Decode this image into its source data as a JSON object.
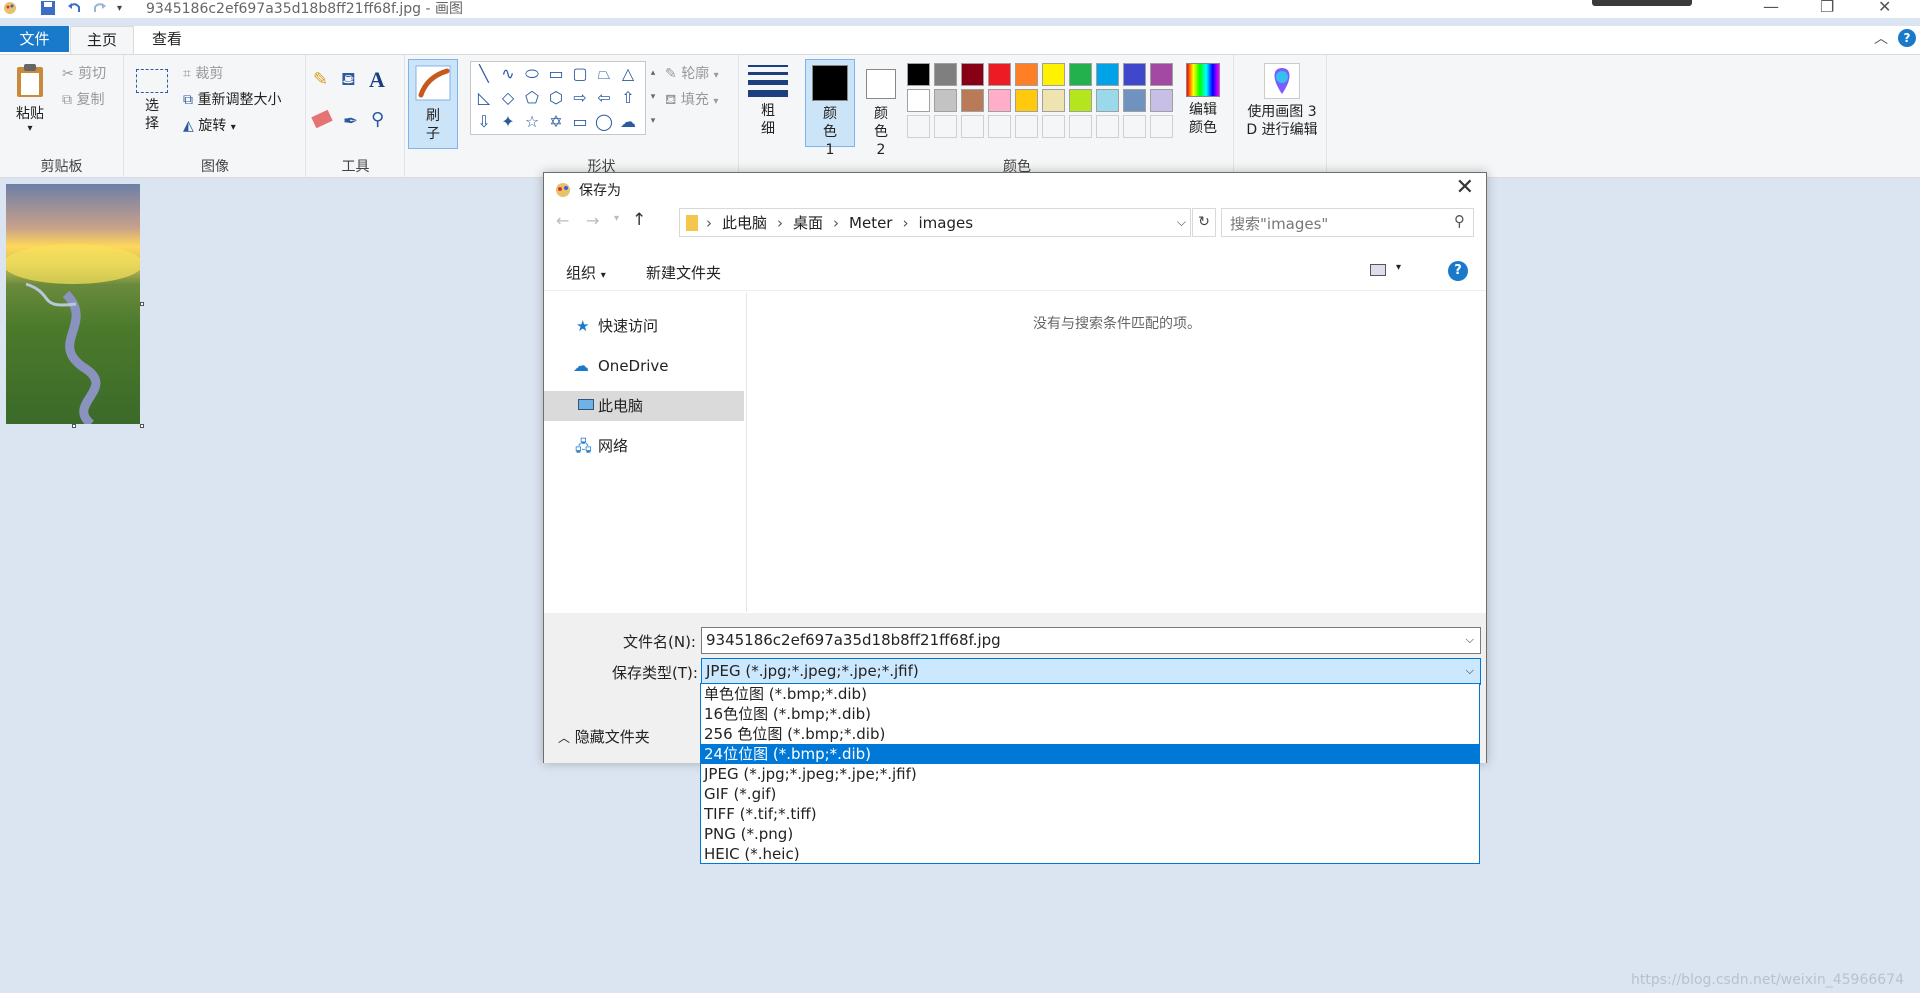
{
  "window": {
    "title": "9345186c2ef697a35d18b8ff21ff68f.jpg - 画图"
  },
  "ribbon_tabs": [
    "文件",
    "主页",
    "查看"
  ],
  "ribbon": {
    "clipboard": {
      "paste": "粘贴",
      "cut": "剪切",
      "copy": "复制",
      "group": "剪贴板"
    },
    "image": {
      "select": "选择",
      "crop": "裁剪",
      "resize": "重新调整大小",
      "rotate": "旋转",
      "group": "图像"
    },
    "tools": {
      "group": "工具"
    },
    "brushes": {
      "label": "刷子"
    },
    "shapes": {
      "outline": "轮廓",
      "fill": "填充",
      "group": "形状"
    },
    "size": {
      "label": "粗细"
    },
    "colors": {
      "color1": "颜色 1",
      "color2": "颜色 2",
      "edit": "编辑颜色",
      "group": "颜色",
      "palette_row1": [
        "#000000",
        "#7f7f7f",
        "#880015",
        "#ed1c24",
        "#ff7f27",
        "#fff200",
        "#22b14c",
        "#00a2e8",
        "#3f48cc",
        "#a349a4"
      ],
      "palette_row2": [
        "#ffffff",
        "#c3c3c3",
        "#b97a57",
        "#ffaec9",
        "#ffc90e",
        "#efe4b0",
        "#b5e61d",
        "#99d9ea",
        "#7092be",
        "#c8bfe7"
      ]
    },
    "paint3d": "使用画图 3 D 进行编辑"
  },
  "dialog": {
    "title": "保存为",
    "breadcrumb": [
      "此电脑",
      "桌面",
      "Meter",
      "images"
    ],
    "search_placeholder": "搜索\"images\"",
    "toolbar": {
      "organize": "组织",
      "new_folder": "新建文件夹"
    },
    "sidebar": [
      "快速访问",
      "OneDrive",
      "此电脑",
      "网络"
    ],
    "empty_message": "没有与搜索条件匹配的项。",
    "filename_label": "文件名(N):",
    "filename_value": "9345186c2ef697a35d18b8ff21ff68f.jpg",
    "type_label": "保存类型(T):",
    "type_value": "JPEG (*.jpg;*.jpeg;*.jpe;*.jfif)",
    "hide_folders": "隐藏文件夹",
    "type_options": [
      "单色位图 (*.bmp;*.dib)",
      "16色位图 (*.bmp;*.dib)",
      "256 色位图 (*.bmp;*.dib)",
      "24位位图 (*.bmp;*.dib)",
      "JPEG (*.jpg;*.jpeg;*.jpe;*.jfif)",
      "GIF (*.gif)",
      "TIFF (*.tif;*.tiff)",
      "PNG (*.png)",
      "HEIC (*.heic)"
    ]
  },
  "watermark": "https://blog.csdn.net/weixin_45966674"
}
